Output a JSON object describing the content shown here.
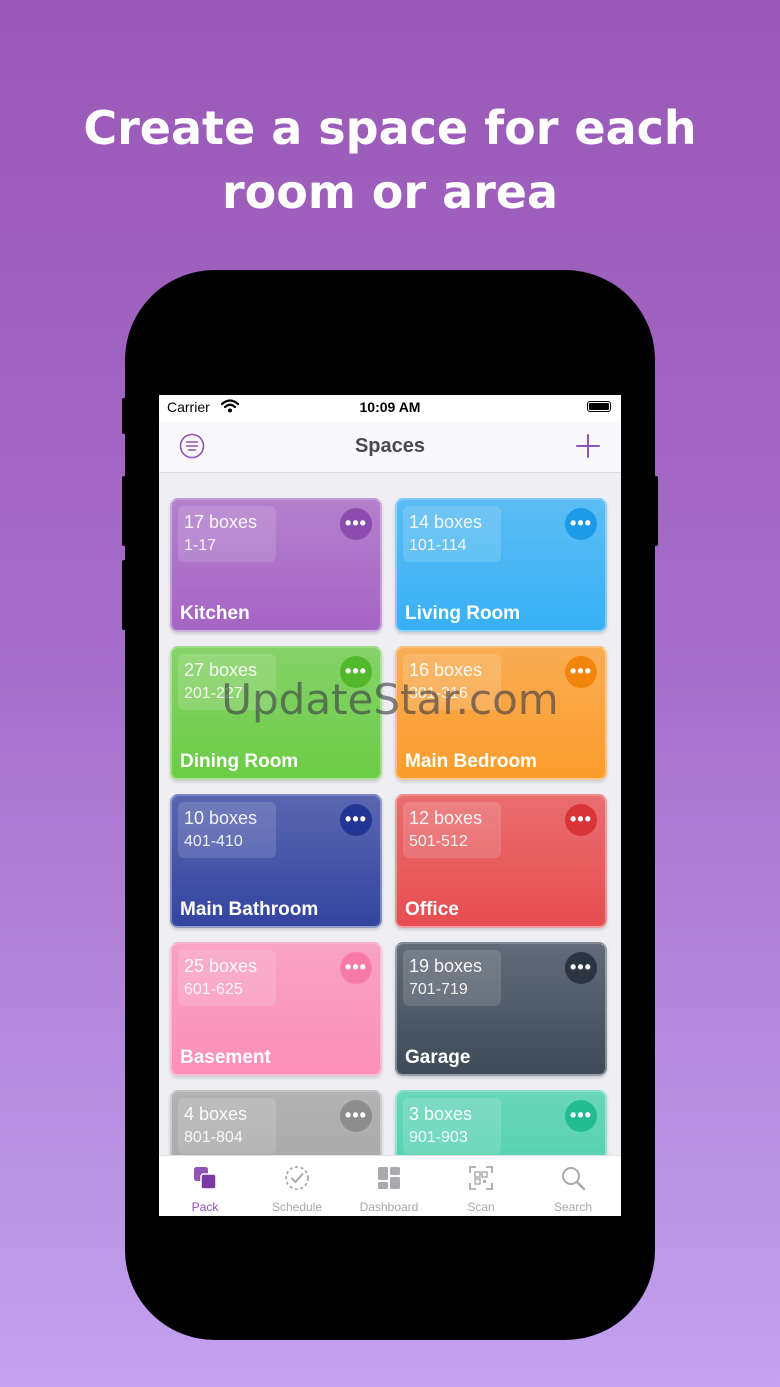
{
  "headline": {
    "line1": "Create a space for each",
    "line2": "room or area"
  },
  "status_bar": {
    "carrier": "Carrier",
    "time": "10:09 AM"
  },
  "nav": {
    "title": "Spaces",
    "menu_icon": "list-menu-icon",
    "add_icon": "plus-icon"
  },
  "spaces": [
    {
      "count": "17 boxes",
      "range": "1-17",
      "name": "Kitchen",
      "color": "#a464c3",
      "dot": "#8c4cad"
    },
    {
      "count": "14 boxes",
      "range": "101-114",
      "name": "Living Room",
      "color": "#37b0f3",
      "dot": "#1c9be8"
    },
    {
      "count": "27 boxes",
      "range": "201-227",
      "name": "Dining Room",
      "color": "#6ccb46",
      "dot": "#52b92c"
    },
    {
      "count": "16 boxes",
      "range": "301-316",
      "name": "Main Bedroom",
      "color": "#fb9c2c",
      "dot": "#f2850c"
    },
    {
      "count": "10 boxes",
      "range": "401-410",
      "name": "Main Bathroom",
      "color": "#34449f",
      "dot": "#223592"
    },
    {
      "count": "12 boxes",
      "range": "501-512",
      "name": "Office",
      "color": "#e74d4f",
      "dot": "#d93437"
    },
    {
      "count": "25 boxes",
      "range": "601-625",
      "name": "Basement",
      "color": "#fb8fb8",
      "dot": "#f77aa6"
    },
    {
      "count": "19 boxes",
      "range": "701-719",
      "name": "Garage",
      "color": "#3e4a58",
      "dot": "#2b3541"
    },
    {
      "count": "4 boxes",
      "range": "801-804",
      "name": "",
      "color": "#a3a3a3",
      "dot": "#8d8d8d"
    },
    {
      "count": "3 boxes",
      "range": "901-903",
      "name": "",
      "color": "#48cfaa",
      "dot": "#24bd92"
    }
  ],
  "more_label": "•••",
  "tabs": [
    {
      "label": "Pack",
      "icon": "pack-icon",
      "active": true
    },
    {
      "label": "Schedule",
      "icon": "schedule-icon",
      "active": false
    },
    {
      "label": "Dashboard",
      "icon": "dashboard-icon",
      "active": false
    },
    {
      "label": "Scan",
      "icon": "qr-scan-icon",
      "active": false
    },
    {
      "label": "Search",
      "icon": "search-icon",
      "active": false
    }
  ],
  "watermark": "UpdateStar.com",
  "colors": {
    "accent": "#9351ba",
    "background_top": "#9a58b7",
    "background_bottom": "#c3a2f0"
  }
}
